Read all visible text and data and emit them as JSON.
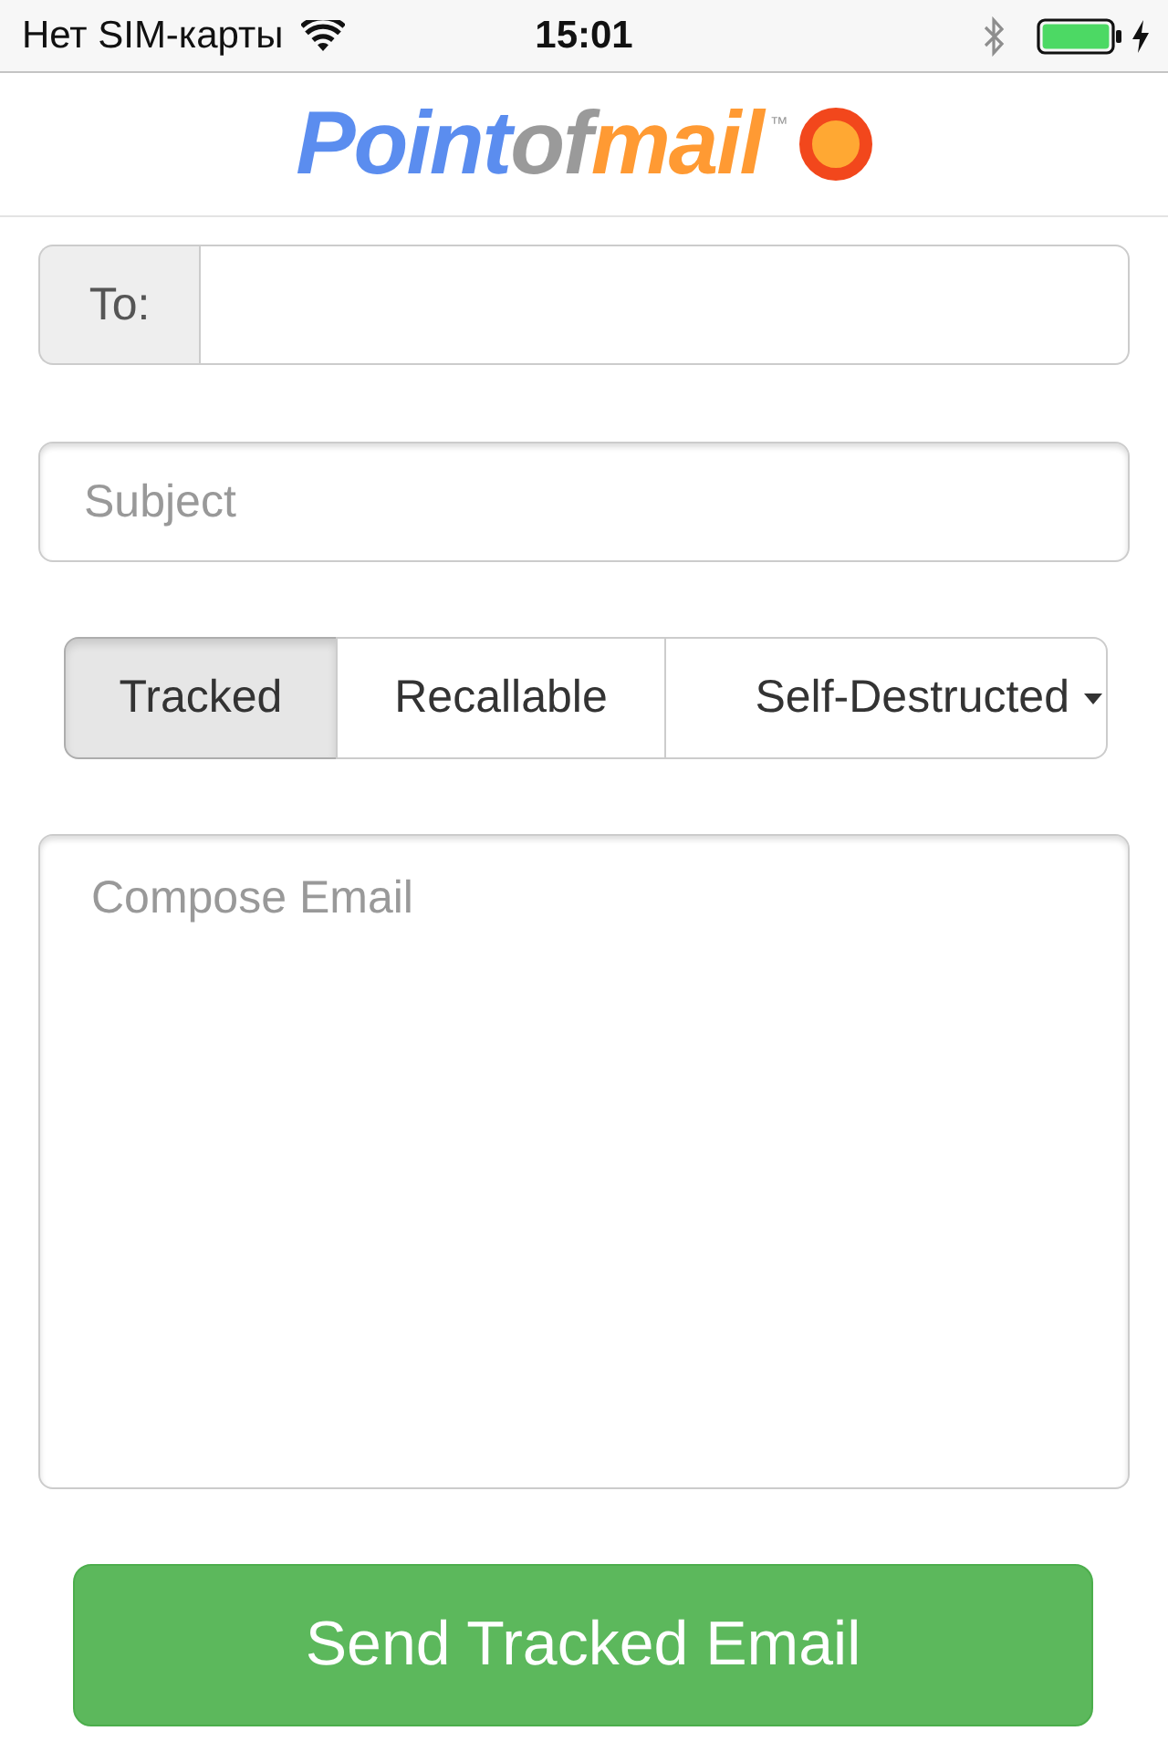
{
  "status_bar": {
    "carrier": "Нет SIM-карты",
    "time": "15:01",
    "charging": true
  },
  "header": {
    "logo": {
      "parts": [
        {
          "text": "Point",
          "color": "#5b8def"
        },
        {
          "text": "of",
          "color": "#9a9a9a"
        },
        {
          "text": "mail",
          "color": "#ff9a33"
        }
      ],
      "trademark": "™"
    }
  },
  "to_field": {
    "label": "To:"
  },
  "subject_field": {
    "placeholder": "Subject"
  },
  "tabs": [
    {
      "label": "Tracked",
      "selected": true,
      "dropdown": false
    },
    {
      "label": "Recallable",
      "selected": false,
      "dropdown": false
    },
    {
      "label": "Self-Destructed",
      "selected": false,
      "dropdown": true
    }
  ],
  "compose_field": {
    "placeholder": "Compose Email"
  },
  "send_button": {
    "label": "Send Tracked Email"
  }
}
